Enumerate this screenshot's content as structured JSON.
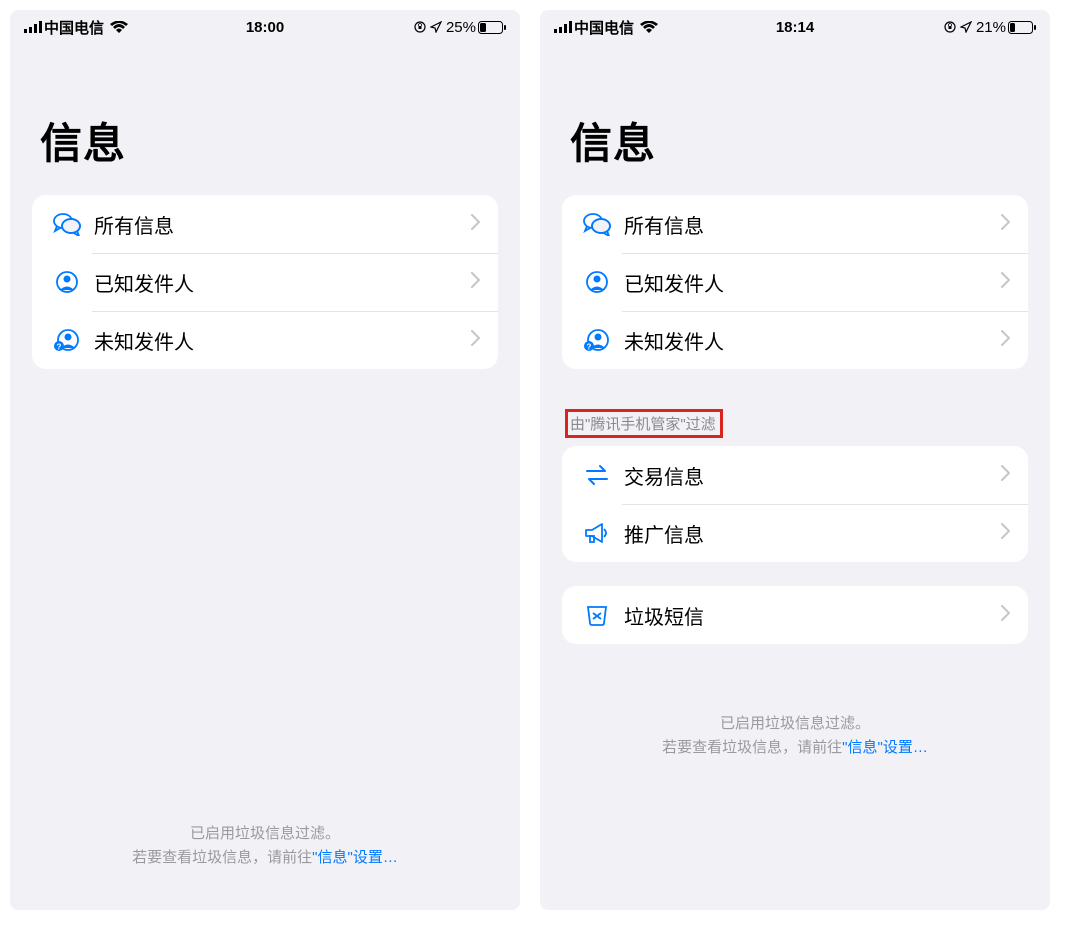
{
  "screens": {
    "left": {
      "status": {
        "carrier": "中国电信",
        "time": "18:00",
        "battery_pct": "25%"
      },
      "title": "信息",
      "rows": [
        {
          "label": "所有信息",
          "icon": "chat"
        },
        {
          "label": "已知发件人",
          "icon": "person"
        },
        {
          "label": "未知发件人",
          "icon": "person-q"
        }
      ],
      "footer_line1": "已启用垃圾信息过滤。",
      "footer_line2_a": "若要查看垃圾信息，请前往",
      "footer_link": "\"信息\"设置…"
    },
    "right": {
      "status": {
        "carrier": "中国电信",
        "time": "18:14",
        "battery_pct": "21%"
      },
      "title": "信息",
      "rows": [
        {
          "label": "所有信息",
          "icon": "chat"
        },
        {
          "label": "已知发件人",
          "icon": "person"
        },
        {
          "label": "未知发件人",
          "icon": "person-q"
        }
      ],
      "section_header": "由\"腾讯手机管家\"过滤",
      "filter_rows": [
        {
          "label": "交易信息",
          "icon": "exchange"
        },
        {
          "label": "推广信息",
          "icon": "megaphone"
        }
      ],
      "junk_rows": [
        {
          "label": "垃圾短信",
          "icon": "trash"
        }
      ],
      "footer_line1": "已启用垃圾信息过滤。",
      "footer_line2_a": "若要查看垃圾信息，请前往",
      "footer_link": "\"信息\"设置…"
    }
  },
  "colors": {
    "accent": "#007aff",
    "highlight_border": "#d9251e"
  }
}
